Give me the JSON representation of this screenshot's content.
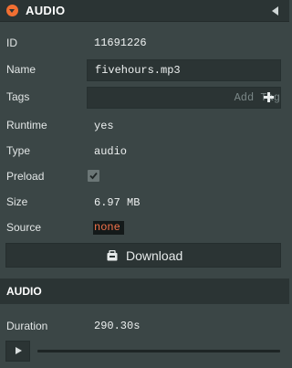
{
  "header": {
    "title": "AUDIO"
  },
  "fields": {
    "id": {
      "label": "ID",
      "value": "11691226"
    },
    "name": {
      "label": "Name",
      "value": "fivehours.mp3"
    },
    "tags": {
      "label": "Tags",
      "placeholder": "Add Tag"
    },
    "runtime": {
      "label": "Runtime",
      "value": "yes"
    },
    "type": {
      "label": "Type",
      "value": "audio"
    },
    "preload": {
      "label": "Preload",
      "checked": true
    },
    "size": {
      "label": "Size",
      "value": "6.97 MB"
    },
    "source": {
      "label": "Source",
      "value": "none"
    }
  },
  "download": {
    "label": "Download",
    "icon": "download-icon"
  },
  "audio_section": {
    "title": "AUDIO",
    "duration_label": "Duration",
    "duration_value": "290.30s",
    "progress": 0
  },
  "colors": {
    "accent": "#f16f32",
    "source_none": "#f4734b",
    "panel_bg": "#3b4646",
    "header_bg": "#2b3434"
  }
}
